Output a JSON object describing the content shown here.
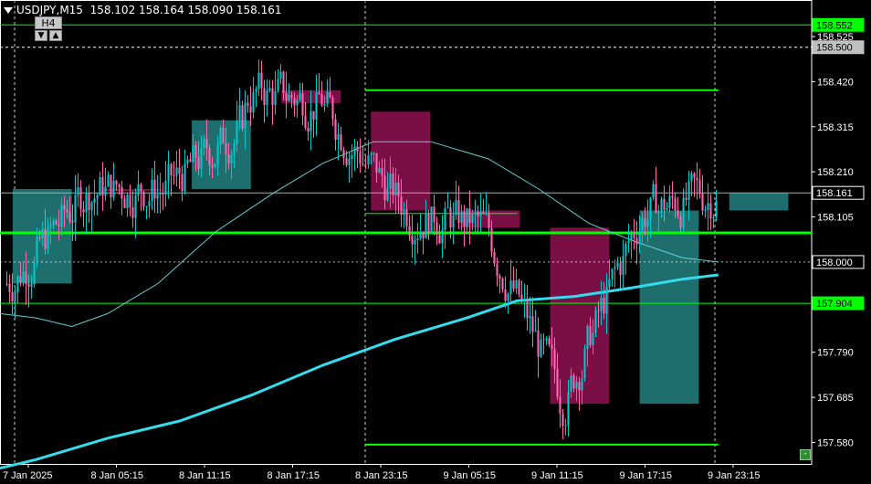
{
  "header": {
    "symbol": "USDJPY",
    "timeframe": "M15",
    "ohlc_text": "158.102 158.164 158.090 158.161",
    "tf_label": "H4",
    "tf_up": "▲",
    "tf_down": "▼"
  },
  "corner_button": "-",
  "colors": {
    "background": "#000000",
    "bull_candle": "#00c8c8",
    "bear_candle": "#ff66b2",
    "bull_box": "#1e6e6e",
    "bear_box": "#7a0f45",
    "level_line": "#00ff00",
    "ma_slow": "#33ddee",
    "ma_fast": "#66cccc",
    "grid_dashed": "#cccccc"
  },
  "chart_data": {
    "type": "candlestick",
    "symbol": "USDJPY",
    "timeframe": "M15",
    "y_range": [
      157.53,
      158.61
    ],
    "y_ticks": [
      "158.525",
      "158.420",
      "158.315",
      "158.210",
      "158.105",
      "157.790",
      "157.685",
      "157.580"
    ],
    "x_labels": [
      "7 Jan 2025",
      "8 Jan 05:15",
      "8 Jan 11:15",
      "8 Jan 17:15",
      "8 Jan 23:15",
      "9 Jan 05:15",
      "9 Jan 11:15",
      "9 Jan 17:15",
      "9 Jan 23:15"
    ],
    "price_tags": [
      {
        "label": "158.552",
        "value": 158.552,
        "style": "green"
      },
      {
        "label": "158.500",
        "value": 158.5,
        "style": "gray"
      },
      {
        "label": "158.161",
        "value": 158.161,
        "style": "white"
      },
      {
        "label": "158.000",
        "value": 158.0,
        "style": "white"
      },
      {
        "label": "157.904",
        "value": 157.904,
        "style": "green"
      }
    ],
    "horizontal_levels": [
      {
        "value": 158.552,
        "style": "thin"
      },
      {
        "value": 158.068,
        "style": "thick"
      },
      {
        "value": 157.904,
        "style": "thin"
      }
    ],
    "segment_levels": [
      {
        "value": 158.4,
        "from_bar": 0.5,
        "to_bar": 1.0
      },
      {
        "value": 157.575,
        "from_bar": 0.5,
        "to_bar": 1.0
      },
      {
        "value": 158.113,
        "from_bar": 0.5,
        "to_bar": 0.72
      }
    ],
    "last_price": 158.161,
    "dashed_level": 158.5,
    "h4_candles": [
      {
        "open": 157.95,
        "close": 158.17,
        "type": "bull"
      },
      {
        "open": 158.17,
        "close": 158.17,
        "type": "bear"
      },
      {
        "open": 158.17,
        "close": 158.33,
        "type": "bull"
      },
      {
        "open": 158.4,
        "close": 158.37,
        "type": "bear"
      },
      {
        "open": 158.35,
        "close": 158.12,
        "type": "bear"
      },
      {
        "open": 158.12,
        "close": 158.08,
        "type": "bear"
      },
      {
        "open": 158.08,
        "close": 157.67,
        "type": "bear"
      },
      {
        "open": 157.67,
        "close": 158.12,
        "type": "bull"
      },
      {
        "open": 158.12,
        "close": 158.16,
        "type": "bull"
      }
    ],
    "ma_slow_path": [
      [
        0,
        157.52
      ],
      [
        0.05,
        157.54
      ],
      [
        0.15,
        157.59
      ],
      [
        0.25,
        157.63
      ],
      [
        0.35,
        157.69
      ],
      [
        0.45,
        157.76
      ],
      [
        0.55,
        157.82
      ],
      [
        0.65,
        157.87
      ],
      [
        0.72,
        157.91
      ],
      [
        0.8,
        157.92
      ],
      [
        0.88,
        157.94
      ],
      [
        0.95,
        157.96
      ],
      [
        1.0,
        157.97
      ]
    ],
    "ma_fast_path": [
      [
        0,
        157.88
      ],
      [
        0.05,
        157.87
      ],
      [
        0.1,
        157.85
      ],
      [
        0.15,
        157.88
      ],
      [
        0.22,
        157.95
      ],
      [
        0.3,
        158.07
      ],
      [
        0.38,
        158.16
      ],
      [
        0.45,
        158.23
      ],
      [
        0.52,
        158.28
      ],
      [
        0.6,
        158.28
      ],
      [
        0.68,
        158.24
      ],
      [
        0.75,
        158.17
      ],
      [
        0.82,
        158.09
      ],
      [
        0.88,
        158.05
      ],
      [
        0.95,
        158.01
      ],
      [
        1.0,
        158.0
      ]
    ]
  }
}
